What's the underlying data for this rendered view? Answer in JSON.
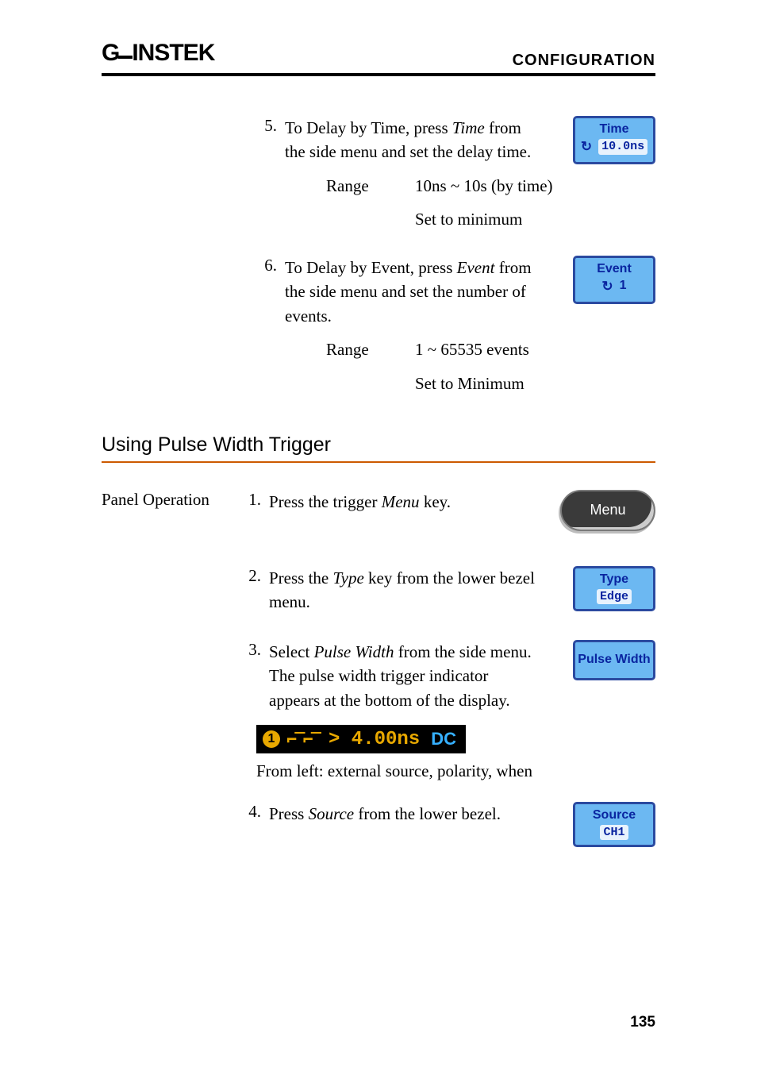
{
  "header": {
    "logo": "GWINSTEK",
    "section": "CONFIGURATION"
  },
  "top_steps": [
    {
      "num": "5.",
      "text_before": "To Delay by Time, press ",
      "italic": "Time",
      "text_after": " from the side menu and set the delay time.",
      "btn": {
        "line1": "Time",
        "value": "10.0ns"
      },
      "range_label": "Range",
      "range_val1": "10ns ~ 10s (by time)",
      "range_val2": "Set to minimum"
    },
    {
      "num": "6.",
      "text_before": "To Delay by Event, press ",
      "italic": "Event",
      "text_after": " from the side menu and set the number of events.",
      "btn": {
        "line1": "Event",
        "value": "1"
      },
      "range_label": "Range",
      "range_val1": "1 ~ 65535  events",
      "range_val2": "Set to Minimum"
    }
  ],
  "section_title": "Using Pulse Width Trigger",
  "panel_label": "Panel Operation",
  "pw_steps": {
    "s1": {
      "num": "1.",
      "text_before": "Press the trigger ",
      "italic": "Menu",
      "text_after": " key.",
      "btn_label": "Menu"
    },
    "s2": {
      "num": "2.",
      "text_before": "Press the ",
      "italic": "Type",
      "text_after": " key from the lower bezel menu.",
      "btn": {
        "line1": "Type",
        "line2": "Edge"
      }
    },
    "s3": {
      "num": "3.",
      "text_before": "Select ",
      "italic": "Pulse Width",
      "text_after": " from the side menu. The pulse width trigger indicator appears at the bottom of the display.",
      "btn": {
        "line1": "Pulse Width"
      }
    },
    "s3_indicator": {
      "source": "1",
      "when": "> 4.00ns",
      "coupling": "DC"
    },
    "s3_caption": "From left: external source, polarity, when",
    "s4": {
      "num": "4.",
      "text_before": "Press ",
      "italic": "Source",
      "text_after": " from the lower bezel.",
      "btn": {
        "line1": "Source",
        "line2": "CH1"
      }
    }
  },
  "page_number": "135"
}
